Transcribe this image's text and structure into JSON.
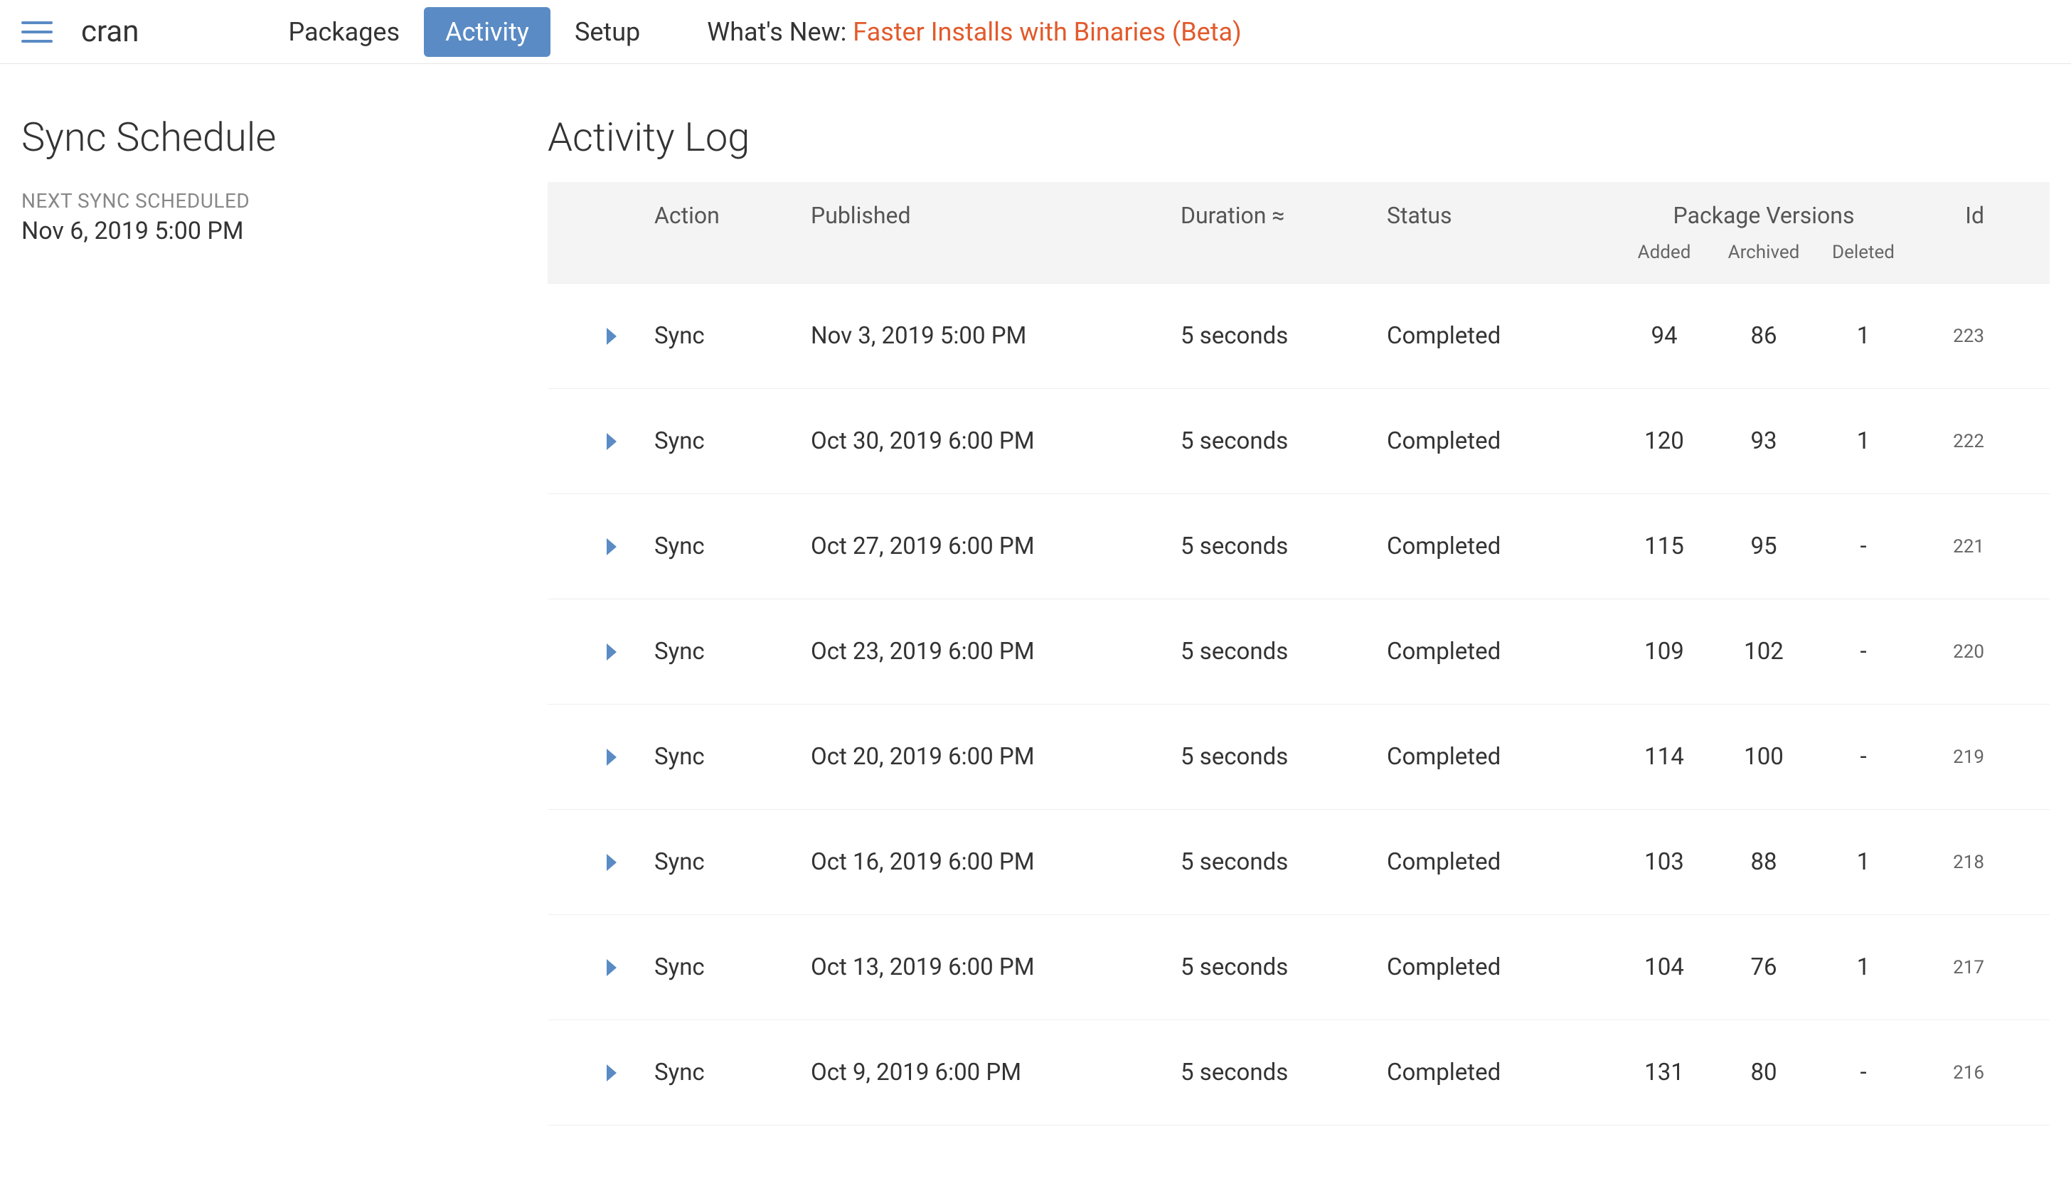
{
  "header": {
    "source_name": "cran",
    "tabs": {
      "packages": "Packages",
      "activity": "Activity",
      "setup": "Setup"
    },
    "whatsnew_label": "What's New: ",
    "whatsnew_link": "Faster Installs with Binaries (Beta)"
  },
  "sidebar": {
    "title": "Sync Schedule",
    "next_sync_label": "NEXT SYNC SCHEDULED",
    "next_sync_time": "Nov 6, 2019 5:00 PM"
  },
  "main": {
    "title": "Activity Log",
    "columns": {
      "action": "Action",
      "published": "Published",
      "duration": "Duration ≈",
      "status": "Status",
      "package_versions": "Package Versions",
      "added": "Added",
      "archived": "Archived",
      "deleted": "Deleted",
      "id": "Id"
    },
    "rows": [
      {
        "action": "Sync",
        "published": "Nov 3, 2019 5:00 PM",
        "duration": "5 seconds",
        "status": "Completed",
        "added": "94",
        "archived": "86",
        "deleted": "1",
        "id": "223"
      },
      {
        "action": "Sync",
        "published": "Oct 30, 2019 6:00 PM",
        "duration": "5 seconds",
        "status": "Completed",
        "added": "120",
        "archived": "93",
        "deleted": "1",
        "id": "222"
      },
      {
        "action": "Sync",
        "published": "Oct 27, 2019 6:00 PM",
        "duration": "5 seconds",
        "status": "Completed",
        "added": "115",
        "archived": "95",
        "deleted": "-",
        "id": "221"
      },
      {
        "action": "Sync",
        "published": "Oct 23, 2019 6:00 PM",
        "duration": "5 seconds",
        "status": "Completed",
        "added": "109",
        "archived": "102",
        "deleted": "-",
        "id": "220"
      },
      {
        "action": "Sync",
        "published": "Oct 20, 2019 6:00 PM",
        "duration": "5 seconds",
        "status": "Completed",
        "added": "114",
        "archived": "100",
        "deleted": "-",
        "id": "219"
      },
      {
        "action": "Sync",
        "published": "Oct 16, 2019 6:00 PM",
        "duration": "5 seconds",
        "status": "Completed",
        "added": "103",
        "archived": "88",
        "deleted": "1",
        "id": "218"
      },
      {
        "action": "Sync",
        "published": "Oct 13, 2019 6:00 PM",
        "duration": "5 seconds",
        "status": "Completed",
        "added": "104",
        "archived": "76",
        "deleted": "1",
        "id": "217"
      },
      {
        "action": "Sync",
        "published": "Oct 9, 2019 6:00 PM",
        "duration": "5 seconds",
        "status": "Completed",
        "added": "131",
        "archived": "80",
        "deleted": "-",
        "id": "216"
      }
    ]
  }
}
